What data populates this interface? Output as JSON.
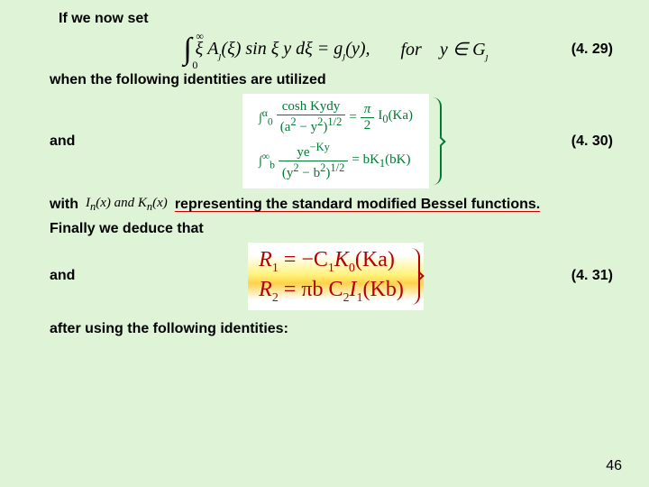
{
  "intro": "If we now set",
  "eq29": {
    "int_lower": "0",
    "int_upper": "∞",
    "body_head": "ξ A",
    "body_sub_j": "ȷ",
    "body_mid": "(ξ) sin ξ y dξ = g",
    "body_tail": "(y),",
    "for_label": "for",
    "domain": "y ∈ G",
    "tag": "(4. 29)"
  },
  "when_line": "when the following identities are utilized",
  "and_label": "and",
  "eq30": {
    "row1": {
      "pre_a": "∫",
      "pre_b": "α",
      "pre_c": "0",
      "num": "cosh Kydy",
      "den_a": "(a",
      "den_b": "2",
      "den_c": " − y",
      "den_d": "2",
      "den_e": ")",
      "den_f": "1/2",
      "eq": " = ",
      "rhs_num": "π",
      "rhs_den": "2",
      "rhs_tail_a": " I",
      "rhs_tail_b": "0",
      "rhs_tail_c": "(Ka)"
    },
    "row2": {
      "pre_a": "∫",
      "pre_b": "∞",
      "pre_c": "b",
      "num_a": "ye",
      "num_b": "−Ky",
      "den_a": "(y",
      "den_b": "2",
      "den_c": " − b",
      "den_d": "2",
      "den_e": ")",
      "den_f": "1/2",
      "eq": " = bK",
      "rhs_sub": "1",
      "rhs_tail": "(bK)"
    },
    "tag": "(4. 30)"
  },
  "with_label": "with",
  "with_eq_a": "I",
  "with_eq_b": "n",
  "with_eq_c": "(x)  and  K",
  "with_eq_d": "n",
  "with_eq_e": "(x)",
  "with_tail": "representing the standard modified Bessel functions.",
  "finally_line": "Finally we deduce that",
  "eq31": {
    "row1_a": "R",
    "row1_b": "1",
    "row1_c": " = −C",
    "row1_d": "1",
    "row1_e": "K",
    "row1_f": "0",
    "row1_g": "(Ka)",
    "row2_a": "R",
    "row2_b": "2",
    "row2_c": " = πb C",
    "row2_d": "2",
    "row2_e": "I",
    "row2_f": "1",
    "row2_g": "(Kb)",
    "tag": "(4. 31)"
  },
  "after_line": "after using the following identities:",
  "page_number": "46"
}
